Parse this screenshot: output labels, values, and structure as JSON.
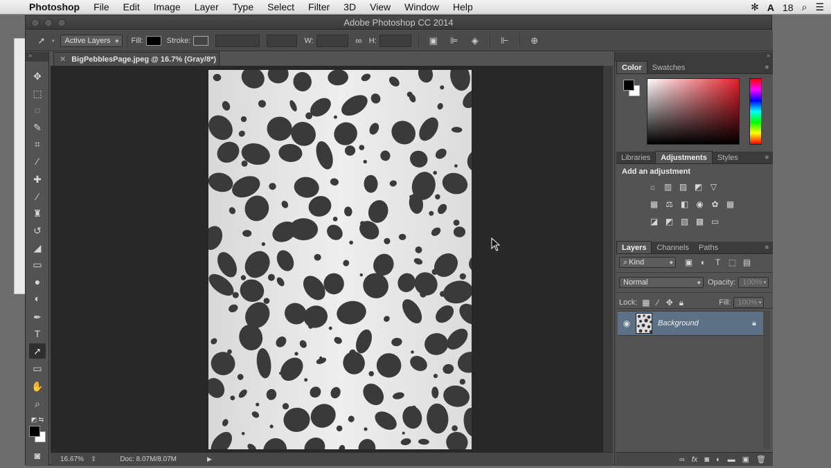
{
  "menubar": {
    "app": "Photoshop",
    "items": [
      "File",
      "Edit",
      "Image",
      "Layer",
      "Type",
      "Select",
      "Filter",
      "3D",
      "View",
      "Window",
      "Help"
    ],
    "right_status": "18"
  },
  "window": {
    "title": "Adobe Photoshop CC 2014"
  },
  "options_bar": {
    "mode_label": "Active Layers",
    "fill_label": "Fill:",
    "stroke_label": "Stroke:",
    "w_label": "W:",
    "h_label": "H:"
  },
  "document": {
    "tab_label": "BigPebblesPage.jpeg @ 16.7% (Gray/8*)",
    "zoom": "16.67%",
    "doc_info": "Doc: 8.07M/8.07M"
  },
  "panels": {
    "color_tabs": [
      "Color",
      "Swatches"
    ],
    "adjust_tabs": [
      "Libraries",
      "Adjustments",
      "Styles"
    ],
    "adjust_title": "Add an adjustment",
    "layers_tabs": [
      "Layers",
      "Channels",
      "Paths"
    ],
    "kind_label": "Kind",
    "blend_mode": "Normal",
    "opacity_label": "Opacity:",
    "opacity_value": "100%",
    "lock_label": "Lock:",
    "fill_label": "Fill:",
    "fill_value": "100%",
    "layer_name": "Background"
  },
  "colors": {
    "foreground": "#000000",
    "background": "#ffffff",
    "layer_selected": "#5c7086"
  }
}
